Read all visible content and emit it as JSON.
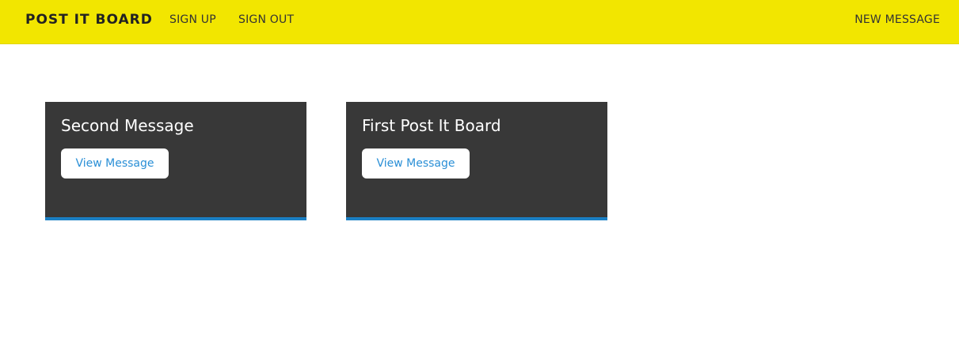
{
  "navbar": {
    "brand": "POST IT BOARD",
    "links": {
      "sign_up": "SIGN UP",
      "sign_out": "SIGN OUT",
      "new_message": "NEW MESSAGE"
    }
  },
  "messages": [
    {
      "title": "Second Message",
      "button_label": "View Message"
    },
    {
      "title": "First Post It Board",
      "button_label": "View Message"
    }
  ],
  "colors": {
    "navbar_bg": "#f2e600",
    "card_bg": "#383838",
    "card_accent": "#1a7fc4",
    "link_blue": "#2a8fd6"
  }
}
